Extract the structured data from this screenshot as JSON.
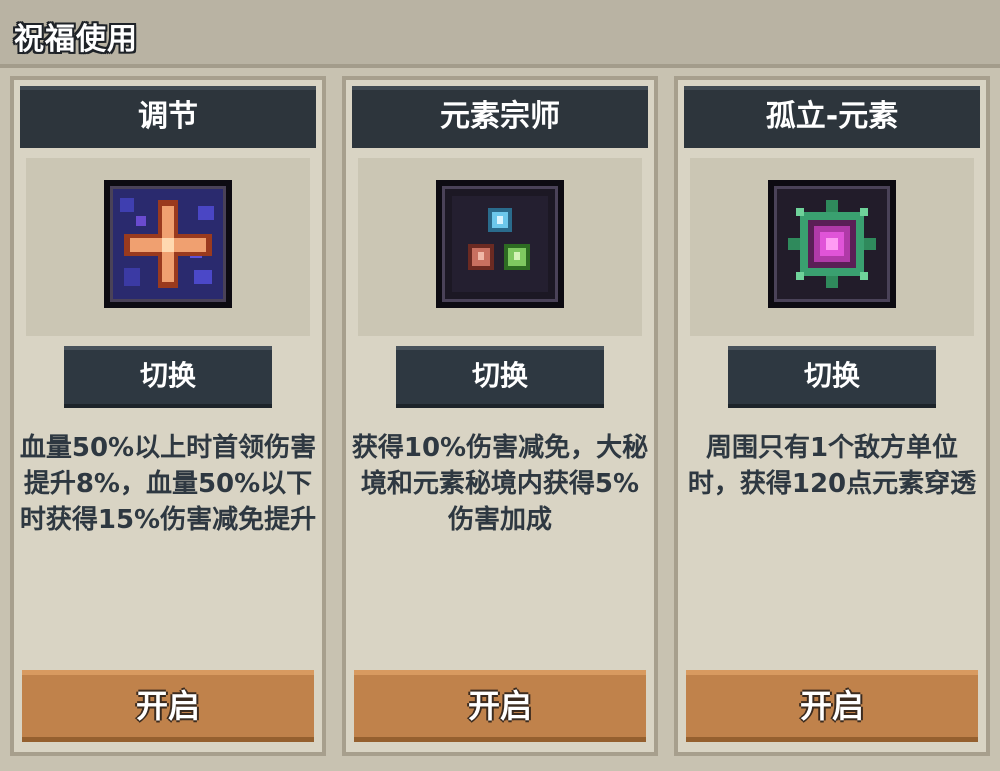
{
  "header": {
    "title": "祝福使用"
  },
  "cards": [
    {
      "name": "调节",
      "icon": "cross-star-icon",
      "switch_label": "切换",
      "description": "血量50%以上时首领伤害提升8%，血量50%以下时获得15%伤害减免提升",
      "open_label": "开启"
    },
    {
      "name": "元素宗师",
      "icon": "three-elements-icon",
      "switch_label": "切换",
      "description": "获得10%伤害减免，大秘境和元素秘境内获得5%伤害加成",
      "open_label": "开启"
    },
    {
      "name": "孤立-元素",
      "icon": "spiked-orb-icon",
      "switch_label": "切换",
      "description": "周围只有1个敌方单位时，获得120点元素穿透",
      "open_label": "开启"
    }
  ],
  "colors": {
    "panel_dark": "#2d353c",
    "open_button": "#c0824b",
    "background": "#c8c2b1",
    "text_dark": "#2e3841"
  }
}
